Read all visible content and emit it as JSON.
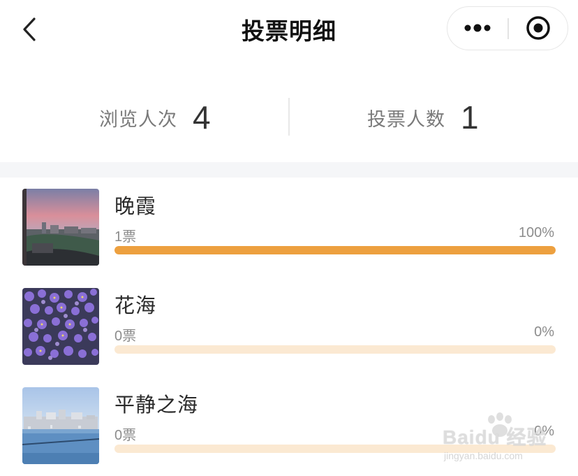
{
  "nav": {
    "title": "投票明细",
    "back_icon": "chevron-left-icon",
    "more_icon": "ellipsis-icon",
    "close_icon": "target-circle-icon"
  },
  "stats": {
    "views_label": "浏览人次",
    "views_value": "4",
    "voters_label": "投票人数",
    "voters_value": "1"
  },
  "items": [
    {
      "name": "晚霞",
      "votes": "1票",
      "percent": "100%",
      "share": 1.0,
      "bar_color": "#eda03f",
      "thumb": "sunset-photo"
    },
    {
      "name": "花海",
      "votes": "0票",
      "percent": "0%",
      "share": 0.0,
      "bar_color": "#eda03f",
      "thumb": "flower-field-photo"
    },
    {
      "name": "平静之海",
      "votes": "0票",
      "percent": "0%",
      "share": 0.0,
      "bar_color": "#eda03f",
      "thumb": "calm-sea-photo"
    }
  ],
  "watermark": {
    "main": "Baidu 经验",
    "sub": "jingyan.baidu.com"
  }
}
